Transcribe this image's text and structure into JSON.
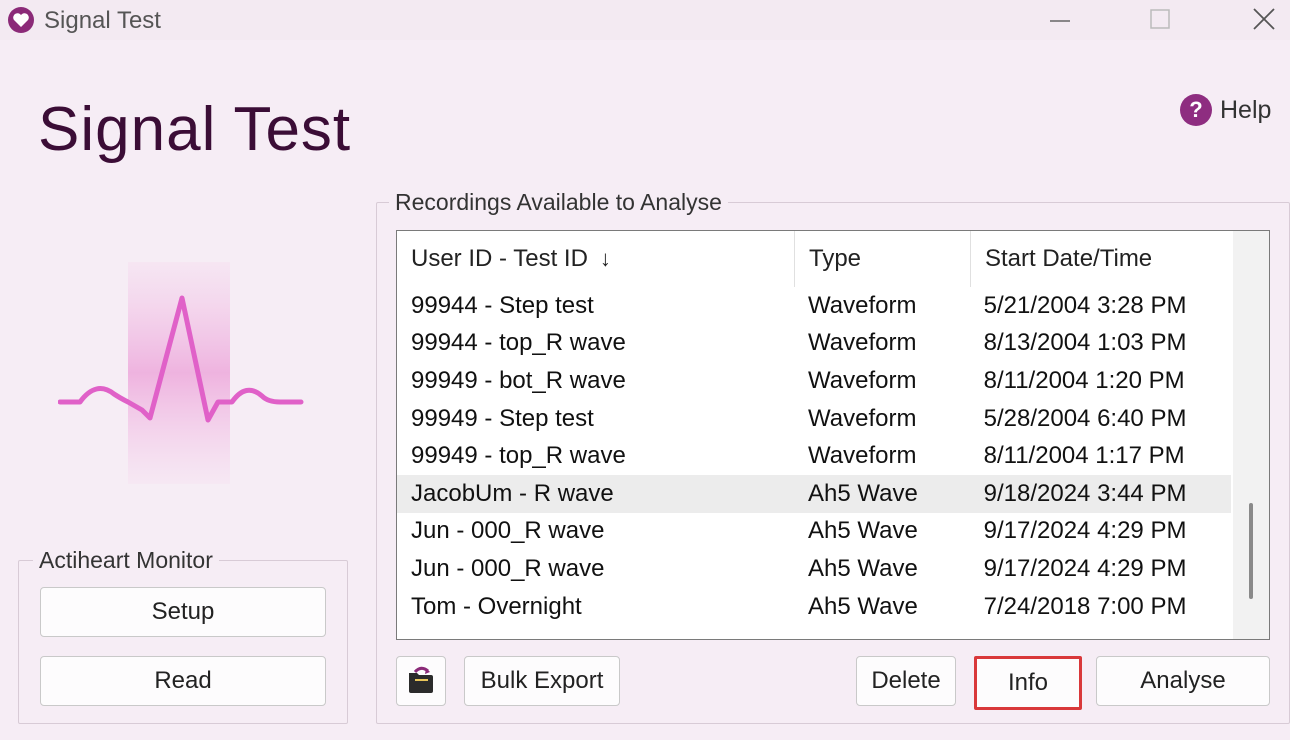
{
  "window": {
    "title": "Signal Test",
    "controls": {
      "minimize": "—",
      "maximize": "☐",
      "close": "✕"
    }
  },
  "page": {
    "title": "Signal Test",
    "help_label": "Help",
    "help_icon": "?"
  },
  "monitor_group": {
    "label": "Actiheart Monitor",
    "setup_label": "Setup",
    "read_label": "Read"
  },
  "recordings": {
    "label": "Recordings Available to Analyse",
    "columns": [
      "User ID - Test ID",
      "Type",
      "Start Date/Time"
    ],
    "sort_indicator": "↓",
    "rows": [
      {
        "id": "99944 - Step test",
        "type": "Waveform",
        "start": "5/21/2004 3:28 PM",
        "selected": false
      },
      {
        "id": "99944 - top_R wave",
        "type": "Waveform",
        "start": "8/13/2004 1:03 PM",
        "selected": false
      },
      {
        "id": "99949 - bot_R wave",
        "type": "Waveform",
        "start": "8/11/2004 1:20 PM",
        "selected": false
      },
      {
        "id": "99949 - Step test",
        "type": "Waveform",
        "start": "5/28/2004 6:40 PM",
        "selected": false
      },
      {
        "id": "99949 - top_R wave",
        "type": "Waveform",
        "start": "8/11/2004 1:17 PM",
        "selected": false
      },
      {
        "id": "JacobUm - R wave",
        "type": "Ah5 Wave",
        "start": "9/18/2024 3:44 PM",
        "selected": true
      },
      {
        "id": "Jun - 000_R wave",
        "type": "Ah5 Wave",
        "start": "9/17/2024 4:29 PM",
        "selected": false
      },
      {
        "id": "Jun - 000_R wave",
        "type": "Ah5 Wave",
        "start": "9/17/2024 4:29 PM",
        "selected": false
      },
      {
        "id": "Tom - Overnight",
        "type": "Ah5 Wave",
        "start": "7/24/2018 7:00 PM",
        "selected": false
      }
    ]
  },
  "actions": {
    "bulk_export_label": "Bulk Export",
    "delete_label": "Delete",
    "info_label": "Info",
    "analyse_label": "Analyse"
  },
  "colors": {
    "accent": "#8b2a78",
    "title": "#3b0d36",
    "highlight_border": "#d9383a",
    "ecg_line": "#e061c8"
  }
}
